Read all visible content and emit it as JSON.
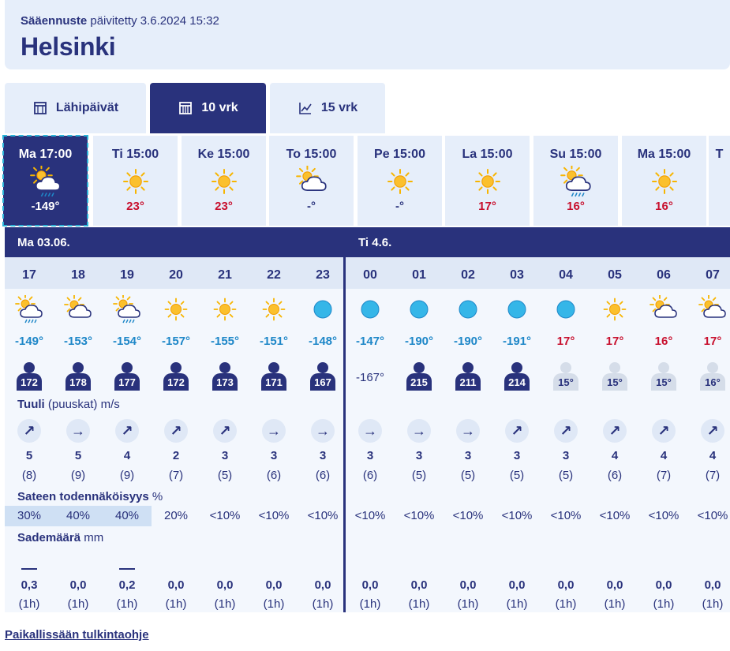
{
  "header": {
    "subtitle_bold": "Sääennuste",
    "subtitle_rest": "päivitetty 3.6.2024 15:32",
    "city": "Helsinki"
  },
  "tabs": [
    {
      "label": "Lähipäivät",
      "icon": "calendar-icon",
      "active": false
    },
    {
      "label": "10 vrk",
      "icon": "calendar-grid-icon",
      "active": true
    },
    {
      "label": "15 vrk",
      "icon": "line-chart-icon",
      "active": false
    }
  ],
  "days": [
    {
      "label": "Ma 17:00",
      "icon": "sun-cloud-rain",
      "temp": "-149°"
    },
    {
      "label": "Ti 15:00",
      "icon": "sun",
      "temp": "23°"
    },
    {
      "label": "Ke 15:00",
      "icon": "sun",
      "temp": "23°"
    },
    {
      "label": "To 15:00",
      "icon": "sun-cloud",
      "temp": "-°"
    },
    {
      "label": "Pe 15:00",
      "icon": "sun",
      "temp": "-°"
    },
    {
      "label": "La 15:00",
      "icon": "sun",
      "temp": "17°"
    },
    {
      "label": "Su 15:00",
      "icon": "sun-cloud-rain",
      "temp": "16°"
    },
    {
      "label": "Ma 15:00",
      "icon": "sun",
      "temp": "16°"
    },
    {
      "label": "T",
      "icon": "",
      "temp": ""
    }
  ],
  "day_headers": [
    "Ma  03.06.",
    "Ti  4.6."
  ],
  "sections": {
    "wind_bold": "Tuuli",
    "wind_rest": "(puuskat) m/s",
    "prob_bold": "Sateen todennäköisyys",
    "prob_rest": "%",
    "rain_bold": "Sademäärä",
    "rain_rest": "mm"
  },
  "hours": [
    {
      "h": "17",
      "icon": "sun-cloud-rain",
      "temp": "-149°",
      "tclass": "cold",
      "feels": "172",
      "feels_style": "dark",
      "dir": "↗",
      "speed": "5",
      "gust": "(8)",
      "prob": "30%",
      "hl": true,
      "bar": true,
      "rain": "0,3",
      "per": "(1h)"
    },
    {
      "h": "18",
      "icon": "sun-cloud",
      "temp": "-153°",
      "tclass": "cold",
      "feels": "178",
      "feels_style": "dark",
      "dir": "→",
      "speed": "5",
      "gust": "(9)",
      "prob": "40%",
      "hl": true,
      "bar": false,
      "rain": "0,0",
      "per": "(1h)"
    },
    {
      "h": "19",
      "icon": "sun-cloud-rain",
      "temp": "-154°",
      "tclass": "cold",
      "feels": "177",
      "feels_style": "dark",
      "dir": "↗",
      "speed": "4",
      "gust": "(9)",
      "prob": "40%",
      "hl": true,
      "bar": true,
      "rain": "0,2",
      "per": "(1h)"
    },
    {
      "h": "20",
      "icon": "sun",
      "temp": "-157°",
      "tclass": "cold",
      "feels": "172",
      "feels_style": "dark",
      "dir": "↗",
      "speed": "2",
      "gust": "(7)",
      "prob": "20%",
      "hl": false,
      "bar": false,
      "rain": "0,0",
      "per": "(1h)"
    },
    {
      "h": "21",
      "icon": "sun",
      "temp": "-155°",
      "tclass": "cold",
      "feels": "173",
      "feels_style": "dark",
      "dir": "↗",
      "speed": "3",
      "gust": "(5)",
      "prob": "<10%",
      "hl": false,
      "bar": false,
      "rain": "0,0",
      "per": "(1h)"
    },
    {
      "h": "22",
      "icon": "sun",
      "temp": "-151°",
      "tclass": "cold",
      "feels": "171",
      "feels_style": "dark",
      "dir": "→",
      "speed": "3",
      "gust": "(6)",
      "prob": "<10%",
      "hl": false,
      "bar": false,
      "rain": "0,0",
      "per": "(1h)"
    },
    {
      "h": "23",
      "icon": "moon",
      "temp": "-148°",
      "tclass": "cold",
      "feels": "167",
      "feels_style": "dark",
      "dir": "→",
      "speed": "3",
      "gust": "(6)",
      "prob": "<10%",
      "hl": false,
      "bar": false,
      "rain": "0,0",
      "per": "(1h)"
    },
    {
      "h": "00",
      "icon": "moon",
      "temp": "-147°",
      "tclass": "cold",
      "feels": "-167°",
      "feels_style": "text",
      "dir": "→",
      "speed": "3",
      "gust": "(6)",
      "prob": "<10%",
      "hl": false,
      "bar": false,
      "rain": "0,0",
      "per": "(1h)"
    },
    {
      "h": "01",
      "icon": "moon",
      "temp": "-190°",
      "tclass": "cold",
      "feels": "215",
      "feels_style": "dark",
      "dir": "→",
      "speed": "3",
      "gust": "(5)",
      "prob": "<10%",
      "hl": false,
      "bar": false,
      "rain": "0,0",
      "per": "(1h)"
    },
    {
      "h": "02",
      "icon": "moon",
      "temp": "-190°",
      "tclass": "cold",
      "feels": "211",
      "feels_style": "dark",
      "dir": "→",
      "speed": "3",
      "gust": "(5)",
      "prob": "<10%",
      "hl": false,
      "bar": false,
      "rain": "0,0",
      "per": "(1h)"
    },
    {
      "h": "03",
      "icon": "moon",
      "temp": "-191°",
      "tclass": "cold",
      "feels": "214",
      "feels_style": "dark",
      "dir": "↗",
      "speed": "3",
      "gust": "(5)",
      "prob": "<10%",
      "hl": false,
      "bar": false,
      "rain": "0,0",
      "per": "(1h)"
    },
    {
      "h": "04",
      "icon": "moon",
      "temp": "17°",
      "tclass": "warm",
      "feels": "15°",
      "feels_style": "light",
      "dir": "↗",
      "speed": "3",
      "gust": "(5)",
      "prob": "<10%",
      "hl": false,
      "bar": false,
      "rain": "0,0",
      "per": "(1h)"
    },
    {
      "h": "05",
      "icon": "sun",
      "temp": "17°",
      "tclass": "warm",
      "feels": "15°",
      "feels_style": "light",
      "dir": "↗",
      "speed": "4",
      "gust": "(6)",
      "prob": "<10%",
      "hl": false,
      "bar": false,
      "rain": "0,0",
      "per": "(1h)"
    },
    {
      "h": "06",
      "icon": "sun-cloud",
      "temp": "16°",
      "tclass": "warm",
      "feels": "15°",
      "feels_style": "light",
      "dir": "↗",
      "speed": "4",
      "gust": "(7)",
      "prob": "<10%",
      "hl": false,
      "bar": false,
      "rain": "0,0",
      "per": "(1h)"
    },
    {
      "h": "07",
      "icon": "sun-cloud",
      "temp": "17°",
      "tclass": "warm",
      "feels": "16°",
      "feels_style": "light",
      "dir": "↗",
      "speed": "4",
      "gust": "(7)",
      "prob": "<10%",
      "hl": false,
      "bar": false,
      "rain": "0,0",
      "per": "(1h)"
    }
  ],
  "footer_link": "Paikallissään tulkintaohje",
  "colors": {
    "navy": "#29327c",
    "light_bg": "#e6eefa",
    "warm": "#c8102e",
    "cold": "#1e87c8",
    "sun": "#f7b500",
    "moon": "#35b6e8"
  }
}
